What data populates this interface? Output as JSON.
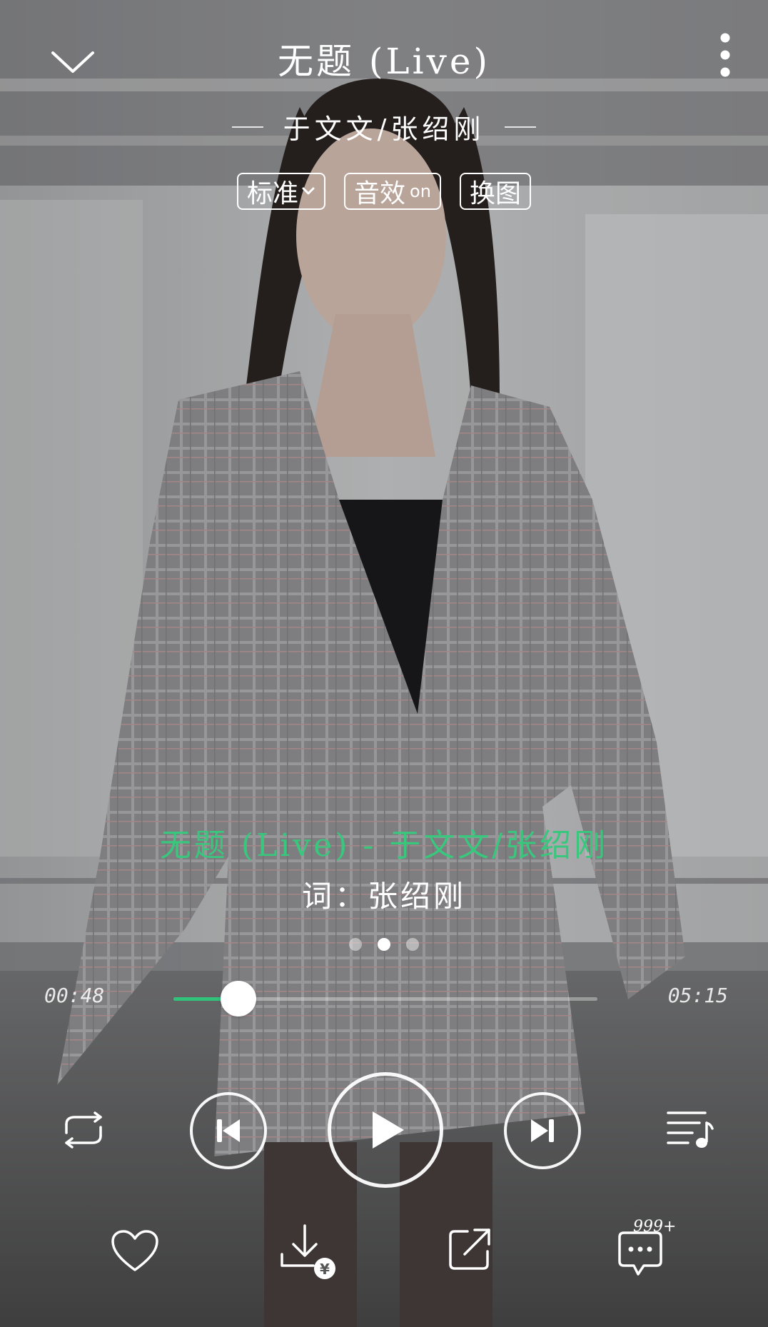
{
  "header": {
    "song_title": "无题 (Live)",
    "artist": "于文文/张绍刚"
  },
  "quality": {
    "standard_label": "标准",
    "effect_label": "音效",
    "effect_state": "on",
    "change_image_label": "换图"
  },
  "lyrics": {
    "current": "无题 (Live) - 于文文/张绍刚",
    "next": "词：张绍刚"
  },
  "pager": {
    "count": 3,
    "active_index": 1
  },
  "progress": {
    "elapsed": "00:48",
    "total": "05:15",
    "fraction": 0.1524
  },
  "controls": {
    "repeat_mode": "loop-icon",
    "prev": "skip-previous-icon",
    "play": "play-icon",
    "next": "skip-next-icon",
    "playlist": "playlist-icon"
  },
  "actions": {
    "comment_count": "999+"
  },
  "colors": {
    "accent": "#31c27c",
    "lyric_current": "#39c77e",
    "foreground": "#ffffff"
  }
}
